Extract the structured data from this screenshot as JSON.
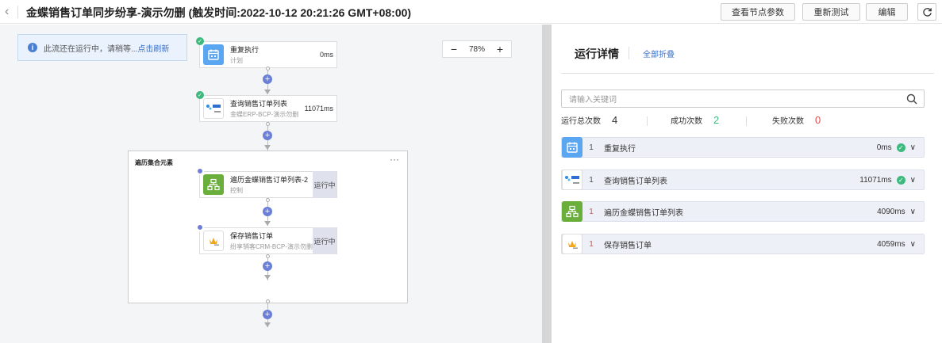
{
  "header": {
    "back_icon": "chevron-left-icon",
    "title": "金蝶销售订单同步纷享-演示勿删 (触发时间:2022-10-12 20:21:26 GMT+08:00)",
    "buttons": {
      "view_params": "查看节点参数",
      "retest": "重新测试",
      "edit": "编辑"
    },
    "refresh_icon": "refresh-icon"
  },
  "canvas": {
    "notice": {
      "text": "此流还在运行中，请稍等...",
      "link": "点击刷新"
    },
    "zoom": {
      "minus": "−",
      "level": "78%",
      "plus": "+"
    },
    "nodes": [
      {
        "name": "重复执行",
        "sub": "计划",
        "time": "0ms",
        "icon": "calendar-icon",
        "status": "success"
      },
      {
        "name": "查询销售订单列表",
        "sub": "金蝶ERP-BCP-演示勿删",
        "time": "11071ms",
        "icon": "kingdee-logo-icon",
        "status": "success"
      }
    ],
    "loop": {
      "title": "遍历集合元素",
      "more": "···",
      "nodes": [
        {
          "name": "遍历金蝶销售订单列表-2",
          "sub": "控制",
          "state": "运行中",
          "icon": "flow-control-icon",
          "status": "running"
        },
        {
          "name": "保存销售订单",
          "sub": "纷享销客CRM-BCP-演示勿删",
          "state": "运行中",
          "icon": "fxiaoke-logo-icon",
          "status": "running"
        }
      ]
    },
    "plus_symbol": "+"
  },
  "panel": {
    "title": "运行详情",
    "collapse_all": "全部折叠",
    "search_placeholder": "请输入关键词",
    "stats": {
      "total_label": "运行总次数",
      "total": "4",
      "success_label": "成功次数",
      "success": "2",
      "fail_label": "失败次数",
      "fail": "0"
    },
    "rows": [
      {
        "count": "1",
        "name": "重复执行",
        "time": "0ms",
        "ok": true,
        "icon": "calendar-icon"
      },
      {
        "count": "1",
        "name": "查询销售订单列表",
        "time": "11071ms",
        "ok": true,
        "icon": "kingdee-logo-icon"
      },
      {
        "count": "1",
        "name": "遍历金蝶销售订单列表",
        "time": "4090ms",
        "ok": false,
        "icon": "flow-control-icon"
      },
      {
        "count": "1",
        "name": "保存销售订单",
        "time": "4059ms",
        "ok": false,
        "icon": "fxiaoke-logo-icon"
      }
    ],
    "check_mark": "✓",
    "chevron": "∨"
  },
  "colors": {
    "accent": "#3a6fc9",
    "success": "#3fba7f",
    "fail": "#e24d4d",
    "node_blue": "#5aa6f0",
    "node_green": "#6aae3b",
    "plus": "#6b7fd7"
  }
}
